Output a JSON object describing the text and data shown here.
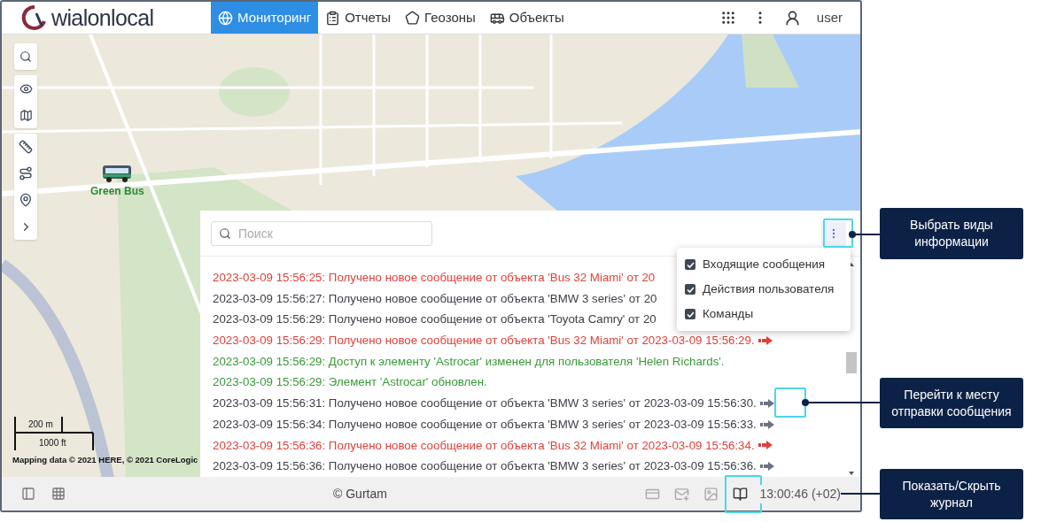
{
  "header": {
    "logo": "wialonlocal",
    "tabs": [
      {
        "kind": "globe",
        "label": "Мониторинг",
        "selected": true
      },
      {
        "kind": "report",
        "label": "Отчеты",
        "selected": false
      },
      {
        "kind": "geofence",
        "label": "Геозоны",
        "selected": false
      },
      {
        "kind": "bus",
        "label": "Объекты",
        "selected": false
      }
    ],
    "user": "user"
  },
  "map": {
    "unit": {
      "name": "Green Bus"
    },
    "scale": {
      "metric": "200 m",
      "imperial": "1000 ft"
    },
    "attribution": "Mapping data © 2021 HERE, © 2021 CoreLogic"
  },
  "log": {
    "search": {
      "placeholder": "Поиск"
    },
    "menu": [
      {
        "label": "Входящие сообщения",
        "checked": true
      },
      {
        "label": "Действия пользователя",
        "checked": true
      },
      {
        "label": "Команды",
        "checked": true
      }
    ],
    "rows": [
      {
        "text": "2023-03-09 15:56:25: Получено новое сообщение от объекта 'Bus 32 Miami' от 20",
        "color": "#e0413a",
        "arrow": false
      },
      {
        "text": "2023-03-09 15:56:27: Получено новое сообщение от объекта 'BMW 3 series' от 20",
        "color": "#3c4048",
        "arrow": false
      },
      {
        "text": "2023-03-09 15:56:29: Получено новое сообщение от объекта 'Toyota Camry' от 20",
        "color": "#3c4048",
        "arrow": false
      },
      {
        "text": "2023-03-09 15:56:29: Получено новое сообщение от объекта 'Bus 32 Miami' от 2023-03-09 15:56:29.",
        "color": "#e0413a",
        "arrow": true
      },
      {
        "text": "2023-03-09 15:56:29: Доступ к элементу 'Astrocar' изменен для пользователя 'Helen Richards'.",
        "color": "#3a9a3a",
        "arrow": false
      },
      {
        "text": "2023-03-09 15:56:29: Элемент 'Astrocar' обновлен.",
        "color": "#3a9a3a",
        "arrow": false
      },
      {
        "text": "2023-03-09 15:56:31: Получено новое сообщение от объекта 'BMW 3 series' от 2023-03-09 15:56:30.",
        "color": "#3c4048",
        "arrow": true
      },
      {
        "text": "2023-03-09 15:56:34: Получено новое сообщение от объекта 'BMW 3 series' от 2023-03-09 15:56:33.",
        "color": "#3c4048",
        "arrow": true
      },
      {
        "text": "2023-03-09 15:56:36: Получено новое сообщение от объекта 'Bus 32 Miami' от 2023-03-09 15:56:34.",
        "color": "#e0413a",
        "arrow": true
      },
      {
        "text": "2023-03-09 15:56:36: Получено новое сообщение от объекта 'BMW 3 series' от 2023-03-09 15:56:36.",
        "color": "#3c4048",
        "arrow": true
      }
    ]
  },
  "footer": {
    "copyright": "© Gurtam",
    "time": "13:00:46 (+02)"
  },
  "callouts": [
    {
      "text": "Выбрать виды информации"
    },
    {
      "text": "Перейти к месту отправки сообщения"
    },
    {
      "text": "Показать/Скрыть журнал"
    }
  ]
}
